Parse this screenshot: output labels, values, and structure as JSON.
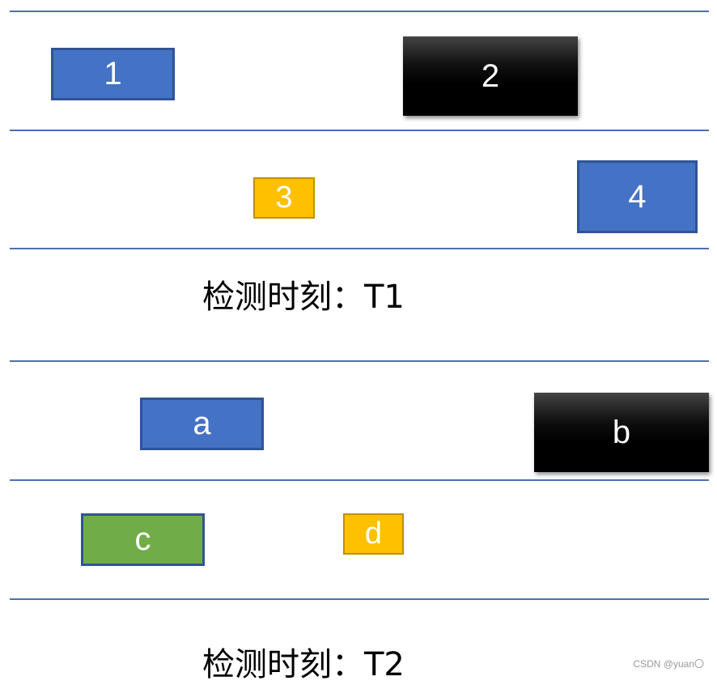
{
  "t1": {
    "boxes": [
      "1",
      "2",
      "3",
      "4"
    ],
    "caption": "检测时刻：T1"
  },
  "t2": {
    "boxes": [
      "a",
      "b",
      "c",
      "d"
    ],
    "caption": "检测时刻：T2"
  },
  "watermark": "CSDN @yuan〇",
  "colors": {
    "blue": "#4472c4",
    "black": "#000000",
    "yellow": "#ffc000",
    "green": "#70ad47",
    "line": "#4a70ad"
  }
}
